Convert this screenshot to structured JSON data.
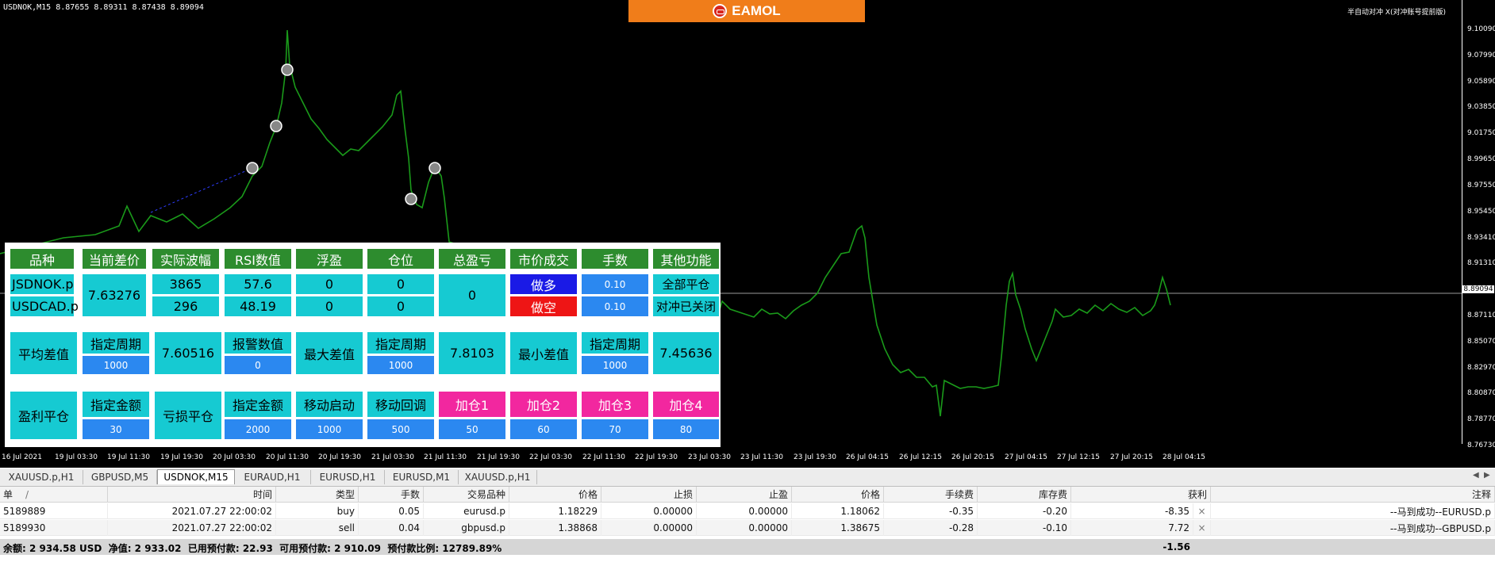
{
  "chart": {
    "symbol_header": "USDNOK,M15  8.87655 8.89311 8.87438 8.89094",
    "ea_title": "半自动对冲 X(对冲账号提前版)",
    "logo_text": "EAMOL",
    "current_price": "8.89094",
    "price_levels": [
      "9.10090",
      "9.07990",
      "9.05890",
      "9.03850",
      "9.01750",
      "8.99650",
      "8.97550",
      "8.95450",
      "8.93410",
      "8.91310",
      "8.89094",
      "8.87110",
      "8.85070",
      "8.82970",
      "8.80870",
      "8.78770",
      "8.76730"
    ],
    "time_labels": [
      "16 Jul 2021",
      "19 Jul 03:30",
      "19 Jul 11:30",
      "19 Jul 19:30",
      "20 Jul 03:30",
      "20 Jul 11:30",
      "20 Jul 19:30",
      "21 Jul 03:30",
      "21 Jul 11:30",
      "21 Jul 19:30",
      "22 Jul 03:30",
      "22 Jul 11:30",
      "22 Jul 19:30",
      "23 Jul 03:30",
      "23 Jul 11:30",
      "23 Jul 19:30",
      "26 Jul 04:15",
      "26 Jul 12:15",
      "26 Jul 20:15",
      "27 Jul 04:15",
      "27 Jul 12:15",
      "27 Jul 20:15",
      "28 Jul 04:15"
    ],
    "line_color": "#1a9a1a"
  },
  "panel": {
    "headers": [
      "品种",
      "当前差价",
      "实际波幅",
      "RSI数值",
      "浮盈",
      "仓位",
      "总盈亏",
      "市价成交",
      "手数",
      "其他功能"
    ],
    "symbol1": "JSDNOK.p",
    "symbol2": "USDCAD.p",
    "current_spread": "7.63276",
    "volatility1": "3865",
    "volatility2": "296",
    "rsi1": "57.6",
    "rsi2": "48.19",
    "float_profit1": "0",
    "float_profit2": "0",
    "position1": "0",
    "position2": "0",
    "total_pnl": "0",
    "buy_label": "做多",
    "sell_label": "做空",
    "lots1": "0.10",
    "lots2": "0.10",
    "close_all_label": "全部平仓",
    "hedge_closed_label": "对冲已关闭",
    "avg_spread_label": "平均差值",
    "period_label": "指定周期",
    "avg_period_value": "1000",
    "avg_spread_value": "7.60516",
    "alert_value_label": "报警数值",
    "alert_value": "0",
    "max_spread_label": "最大差值",
    "max_period_value": "1000",
    "max_spread_value": "7.8103",
    "min_spread_label": "最小差值",
    "min_period_value": "1000",
    "min_spread_value": "7.45636",
    "profit_close_label": "盈利平仓",
    "amount_label": "指定金额",
    "profit_amount": "30",
    "loss_close_label": "亏损平仓",
    "loss_amount": "2000",
    "trail_start_label": "移动启动",
    "trail_start_value": "1000",
    "trail_back_label": "移动回调",
    "trail_back_value": "500",
    "add_labels": [
      "加仓1",
      "加仓2",
      "加仓3",
      "加仓4"
    ],
    "add_values": [
      "50",
      "60",
      "70",
      "80"
    ]
  },
  "tabs": [
    "XAUUSD.p,H1",
    "GBPUSD,M5",
    "USDNOK,M15",
    "EURAUD,H1",
    "EURUSD,H1",
    "EURUSD,M1",
    "XAUUSD.p,H1"
  ],
  "active_tab": "USDNOK,M15",
  "table": {
    "headers": [
      "单",
      "时间",
      "类型",
      "手数",
      "交易品种",
      "价格",
      "止损",
      "止盈",
      "价格",
      "手续费",
      "库存费",
      "获利",
      "注释"
    ],
    "sort_mark": "/",
    "rows": [
      {
        "ticket": "5189889",
        "time": "2021.07.27 22:00:02",
        "type": "buy",
        "lots": "0.05",
        "symbol": "eurusd.p",
        "open_price": "1.18229",
        "sl": "0.00000",
        "tp": "0.00000",
        "price": "1.18062",
        "commission": "-0.35",
        "swap": "-0.20",
        "profit": "-8.35",
        "comment": "--马到成功--EURUSD.p"
      },
      {
        "ticket": "5189930",
        "time": "2021.07.27 22:00:02",
        "type": "sell",
        "lots": "0.04",
        "symbol": "gbpusd.p",
        "open_price": "1.38868",
        "sl": "0.00000",
        "tp": "0.00000",
        "price": "1.38675",
        "commission": "-0.28",
        "swap": "-0.10",
        "profit": "7.72",
        "comment": "--马到成功--GBPUSD.p"
      }
    ],
    "close_mark": "×",
    "summary": "余额: 2 934.58 USD  净值: 2 933.02  已用预付款: 22.93  可用预付款: 2 910.09  预付款比例: 12789.89%",
    "summary_profit": "-1.56"
  }
}
